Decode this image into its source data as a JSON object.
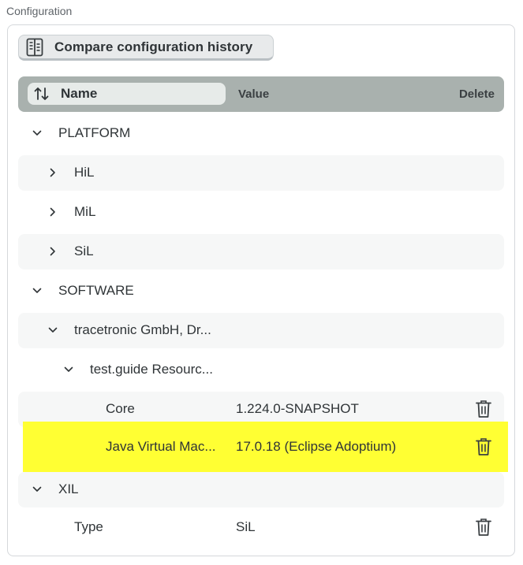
{
  "section": {
    "label": "Configuration"
  },
  "toolbar": {
    "compare_label": "Compare configuration history",
    "compare_icon": "compare-history-icon"
  },
  "table": {
    "headers": {
      "name": "Name",
      "value": "Value",
      "delete": "Delete"
    },
    "rows": [
      {
        "label": "PLATFORM",
        "value": "",
        "expanded": true,
        "level": 0
      },
      {
        "label": "HiL",
        "value": "",
        "expanded": false,
        "level": 1
      },
      {
        "label": "MiL",
        "value": "",
        "expanded": false,
        "level": 1
      },
      {
        "label": "SiL",
        "value": "",
        "expanded": false,
        "level": 1
      },
      {
        "label": "SOFTWARE",
        "value": "",
        "expanded": true,
        "level": 0
      },
      {
        "label": "tracetronic GmbH, Dr...",
        "value": "",
        "expanded": true,
        "level": 1
      },
      {
        "label": "test.guide Resourc...",
        "value": "",
        "expanded": true,
        "level": 2
      },
      {
        "label": "Core",
        "value": "1.224.0-SNAPSHOT",
        "level": 3,
        "deletable": true
      },
      {
        "label": "Java Virtual Mac...",
        "value": "17.0.18 (Eclipse Adoptium)",
        "level": 3,
        "deletable": true,
        "highlighted": true
      },
      {
        "label": "XIL",
        "value": "",
        "expanded": true,
        "level": 0
      },
      {
        "label": "Type",
        "value": "SiL",
        "level": 1,
        "deletable": true
      }
    ]
  },
  "colors": {
    "header_bg": "#a9b1ae",
    "highlight": "#ffff33",
    "stripe": "#f6f7f7"
  }
}
